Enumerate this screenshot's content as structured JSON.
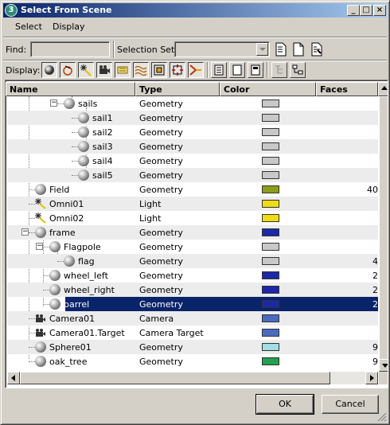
{
  "window": {
    "title": "Select From Scene",
    "app_icon_glyph": "3"
  },
  "menu": {
    "select": "Select",
    "display": "Display"
  },
  "find": {
    "label": "Find:",
    "value": ""
  },
  "selection_set": {
    "label": "Selection Set:",
    "value": ""
  },
  "display": {
    "label": "Display:"
  },
  "columns": {
    "name": "Name",
    "type": "Type",
    "color": "Color",
    "faces": "Faces"
  },
  "rows": [
    {
      "name": "sails",
      "type": "Geometry",
      "color": "#c8c8c8",
      "faces": "",
      "icon": "sphere-icon",
      "level": 2,
      "expander": "minus"
    },
    {
      "name": "sail1",
      "type": "Geometry",
      "color": "#c8c8c8",
      "faces": "",
      "icon": "sphere-icon",
      "level": 3
    },
    {
      "name": "sail2",
      "type": "Geometry",
      "color": "#c8c8c8",
      "faces": "",
      "icon": "sphere-icon",
      "level": 3
    },
    {
      "name": "sail3",
      "type": "Geometry",
      "color": "#c8c8c8",
      "faces": "",
      "icon": "sphere-icon",
      "level": 3
    },
    {
      "name": "sail4",
      "type": "Geometry",
      "color": "#c8c8c8",
      "faces": "",
      "icon": "sphere-icon",
      "level": 3
    },
    {
      "name": "sail5",
      "type": "Geometry",
      "color": "#c8c8c8",
      "faces": "",
      "icon": "sphere-icon",
      "level": 3
    },
    {
      "name": "Field",
      "type": "Geometry",
      "color": "#8c9c1c",
      "faces": "40",
      "icon": "sphere-icon",
      "level": 0
    },
    {
      "name": "Omni01",
      "type": "Light",
      "color": "#f0dc14",
      "faces": "",
      "icon": "light-icon",
      "level": 0
    },
    {
      "name": "Omni02",
      "type": "Light",
      "color": "#f0dc14",
      "faces": "",
      "icon": "light-icon",
      "level": 0
    },
    {
      "name": "frame",
      "type": "Geometry",
      "color": "#1c28a8",
      "faces": "",
      "icon": "sphere-icon",
      "level": 0,
      "expander": "minus"
    },
    {
      "name": "Flagpole",
      "type": "Geometry",
      "color": "#c8c8c8",
      "faces": "",
      "icon": "sphere-icon",
      "level": 1,
      "expander": "minus"
    },
    {
      "name": "flag",
      "type": "Geometry",
      "color": "#c8c8c8",
      "faces": "4",
      "icon": "sphere-icon",
      "level": 2
    },
    {
      "name": "wheel_left",
      "type": "Geometry",
      "color": "#1c28a8",
      "faces": "2",
      "icon": "sphere-icon",
      "level": 1
    },
    {
      "name": "wheel_right",
      "type": "Geometry",
      "color": "#1c28a8",
      "faces": "2",
      "icon": "sphere-icon",
      "level": 1
    },
    {
      "name": "barrel",
      "type": "Geometry",
      "color": "#1c28a8",
      "faces": "2",
      "icon": "sphere-icon",
      "level": 1,
      "selected": true
    },
    {
      "name": "Camera01",
      "type": "Camera",
      "color": "#4a6cc0",
      "faces": "",
      "icon": "camera-icon",
      "level": 0
    },
    {
      "name": "Camera01.Target",
      "type": "Camera Target",
      "color": "#4a6cc0",
      "faces": "",
      "icon": "camera-icon",
      "level": 0
    },
    {
      "name": "Sphere01",
      "type": "Geometry",
      "color": "#a0e0e0",
      "faces": "9",
      "icon": "sphere-icon",
      "level": 0
    },
    {
      "name": "oak_tree",
      "type": "Geometry",
      "color": "#20a050",
      "faces": "9",
      "icon": "sphere-icon",
      "level": 0
    }
  ],
  "buttons": {
    "ok": "OK",
    "cancel": "Cancel"
  },
  "colors": {
    "title_start": "#0a246a",
    "title_end": "#a6caf0",
    "selection": "#0a246a",
    "face": "#d4d0c8"
  }
}
